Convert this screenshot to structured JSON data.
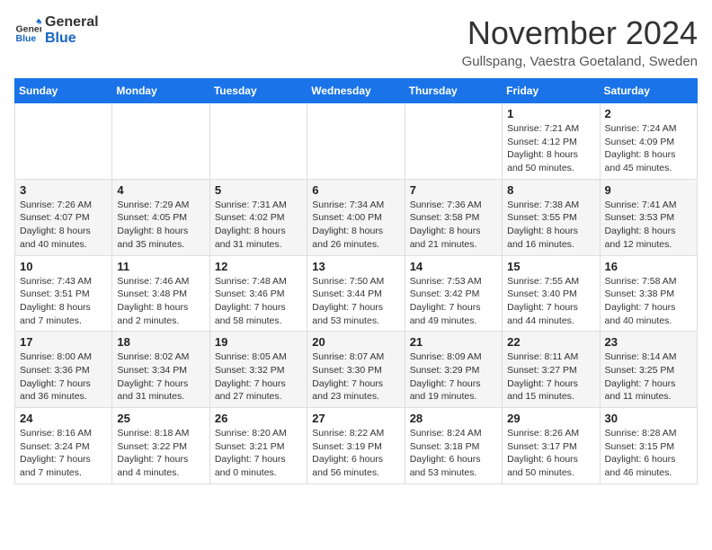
{
  "logo": {
    "general": "General",
    "blue": "Blue"
  },
  "title": "November 2024",
  "location": "Gullspang, Vaestra Goetaland, Sweden",
  "weekdays": [
    "Sunday",
    "Monday",
    "Tuesday",
    "Wednesday",
    "Thursday",
    "Friday",
    "Saturday"
  ],
  "weeks": [
    [
      {
        "day": "",
        "info": ""
      },
      {
        "day": "",
        "info": ""
      },
      {
        "day": "",
        "info": ""
      },
      {
        "day": "",
        "info": ""
      },
      {
        "day": "",
        "info": ""
      },
      {
        "day": "1",
        "info": "Sunrise: 7:21 AM\nSunset: 4:12 PM\nDaylight: 8 hours and 50 minutes."
      },
      {
        "day": "2",
        "info": "Sunrise: 7:24 AM\nSunset: 4:09 PM\nDaylight: 8 hours and 45 minutes."
      }
    ],
    [
      {
        "day": "3",
        "info": "Sunrise: 7:26 AM\nSunset: 4:07 PM\nDaylight: 8 hours and 40 minutes."
      },
      {
        "day": "4",
        "info": "Sunrise: 7:29 AM\nSunset: 4:05 PM\nDaylight: 8 hours and 35 minutes."
      },
      {
        "day": "5",
        "info": "Sunrise: 7:31 AM\nSunset: 4:02 PM\nDaylight: 8 hours and 31 minutes."
      },
      {
        "day": "6",
        "info": "Sunrise: 7:34 AM\nSunset: 4:00 PM\nDaylight: 8 hours and 26 minutes."
      },
      {
        "day": "7",
        "info": "Sunrise: 7:36 AM\nSunset: 3:58 PM\nDaylight: 8 hours and 21 minutes."
      },
      {
        "day": "8",
        "info": "Sunrise: 7:38 AM\nSunset: 3:55 PM\nDaylight: 8 hours and 16 minutes."
      },
      {
        "day": "9",
        "info": "Sunrise: 7:41 AM\nSunset: 3:53 PM\nDaylight: 8 hours and 12 minutes."
      }
    ],
    [
      {
        "day": "10",
        "info": "Sunrise: 7:43 AM\nSunset: 3:51 PM\nDaylight: 8 hours and 7 minutes."
      },
      {
        "day": "11",
        "info": "Sunrise: 7:46 AM\nSunset: 3:48 PM\nDaylight: 8 hours and 2 minutes."
      },
      {
        "day": "12",
        "info": "Sunrise: 7:48 AM\nSunset: 3:46 PM\nDaylight: 7 hours and 58 minutes."
      },
      {
        "day": "13",
        "info": "Sunrise: 7:50 AM\nSunset: 3:44 PM\nDaylight: 7 hours and 53 minutes."
      },
      {
        "day": "14",
        "info": "Sunrise: 7:53 AM\nSunset: 3:42 PM\nDaylight: 7 hours and 49 minutes."
      },
      {
        "day": "15",
        "info": "Sunrise: 7:55 AM\nSunset: 3:40 PM\nDaylight: 7 hours and 44 minutes."
      },
      {
        "day": "16",
        "info": "Sunrise: 7:58 AM\nSunset: 3:38 PM\nDaylight: 7 hours and 40 minutes."
      }
    ],
    [
      {
        "day": "17",
        "info": "Sunrise: 8:00 AM\nSunset: 3:36 PM\nDaylight: 7 hours and 36 minutes."
      },
      {
        "day": "18",
        "info": "Sunrise: 8:02 AM\nSunset: 3:34 PM\nDaylight: 7 hours and 31 minutes."
      },
      {
        "day": "19",
        "info": "Sunrise: 8:05 AM\nSunset: 3:32 PM\nDaylight: 7 hours and 27 minutes."
      },
      {
        "day": "20",
        "info": "Sunrise: 8:07 AM\nSunset: 3:30 PM\nDaylight: 7 hours and 23 minutes."
      },
      {
        "day": "21",
        "info": "Sunrise: 8:09 AM\nSunset: 3:29 PM\nDaylight: 7 hours and 19 minutes."
      },
      {
        "day": "22",
        "info": "Sunrise: 8:11 AM\nSunset: 3:27 PM\nDaylight: 7 hours and 15 minutes."
      },
      {
        "day": "23",
        "info": "Sunrise: 8:14 AM\nSunset: 3:25 PM\nDaylight: 7 hours and 11 minutes."
      }
    ],
    [
      {
        "day": "24",
        "info": "Sunrise: 8:16 AM\nSunset: 3:24 PM\nDaylight: 7 hours and 7 minutes."
      },
      {
        "day": "25",
        "info": "Sunrise: 8:18 AM\nSunset: 3:22 PM\nDaylight: 7 hours and 4 minutes."
      },
      {
        "day": "26",
        "info": "Sunrise: 8:20 AM\nSunset: 3:21 PM\nDaylight: 7 hours and 0 minutes."
      },
      {
        "day": "27",
        "info": "Sunrise: 8:22 AM\nSunset: 3:19 PM\nDaylight: 6 hours and 56 minutes."
      },
      {
        "day": "28",
        "info": "Sunrise: 8:24 AM\nSunset: 3:18 PM\nDaylight: 6 hours and 53 minutes."
      },
      {
        "day": "29",
        "info": "Sunrise: 8:26 AM\nSunset: 3:17 PM\nDaylight: 6 hours and 50 minutes."
      },
      {
        "day": "30",
        "info": "Sunrise: 8:28 AM\nSunset: 3:15 PM\nDaylight: 6 hours and 46 minutes."
      }
    ]
  ]
}
